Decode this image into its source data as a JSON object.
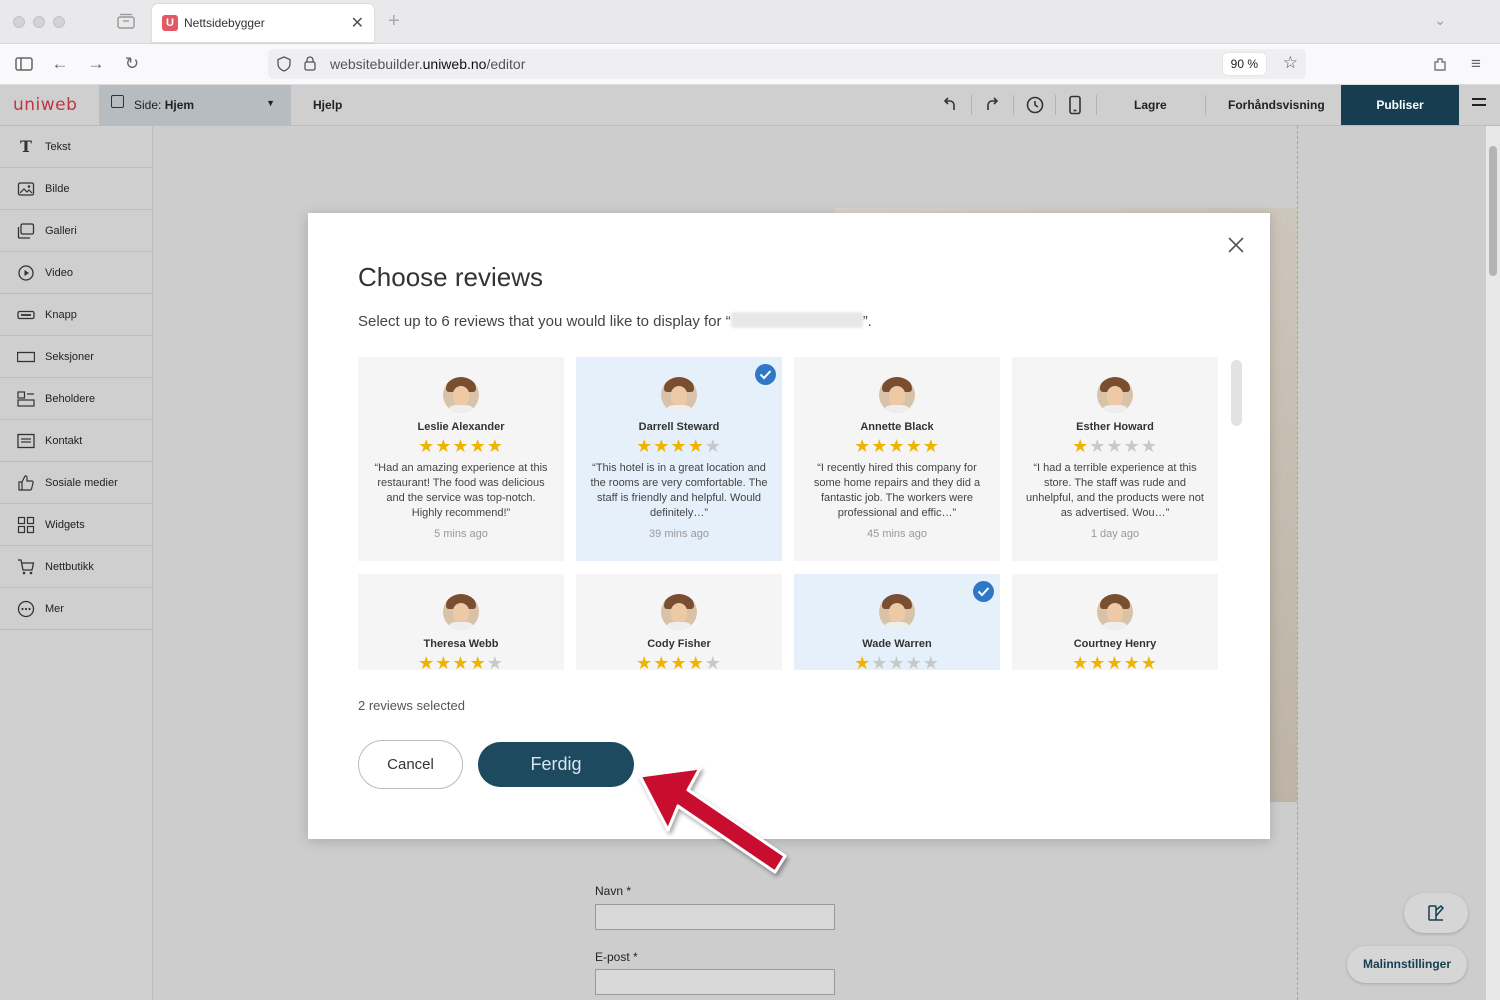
{
  "browser": {
    "tab_title": "Nettsidebygger",
    "tab_favicon": "U",
    "url_host": "websitebuilder.",
    "url_domain": "uniweb.no",
    "url_path": "/editor",
    "zoom": "90 %"
  },
  "editor": {
    "logo": "uniweb",
    "page_label": "Side:",
    "page_name": "Hjem",
    "help": "Hjelp",
    "save": "Lagre",
    "preview": "Forhåndsvisning",
    "publish": "Publiser"
  },
  "sidebar": {
    "items": [
      {
        "label": "Tekst",
        "icon": "text-icon"
      },
      {
        "label": "Bilde",
        "icon": "image-icon"
      },
      {
        "label": "Galleri",
        "icon": "gallery-icon"
      },
      {
        "label": "Video",
        "icon": "video-icon"
      },
      {
        "label": "Knapp",
        "icon": "button-icon"
      },
      {
        "label": "Seksjoner",
        "icon": "section-icon"
      },
      {
        "label": "Beholdere",
        "icon": "container-icon"
      },
      {
        "label": "Kontakt",
        "icon": "contact-icon"
      },
      {
        "label": "Sosiale medier",
        "icon": "thumbs-up-icon"
      },
      {
        "label": "Widgets",
        "icon": "widgets-icon"
      },
      {
        "label": "Nettbutikk",
        "icon": "cart-icon"
      },
      {
        "label": "Mer",
        "icon": "more-icon"
      }
    ]
  },
  "canvas": {
    "form_name_label": "Navn *",
    "form_email_label": "E-post *",
    "template_settings": "Malinnstillinger"
  },
  "modal": {
    "title": "Choose reviews",
    "subtitle_pre": "Select up to 6 reviews that you would like to display for “",
    "subtitle_post": "”.",
    "selected_count": "2 reviews selected",
    "cancel": "Cancel",
    "done": "Ferdig",
    "reviews": [
      {
        "name": "Leslie Alexander",
        "rating": 5,
        "quote": "“Had an amazing experience at this restaurant! The food was delicious and the service was top-notch. Highly recommend!”",
        "time": "5 mins ago",
        "selected": false
      },
      {
        "name": "Darrell Steward",
        "rating": 4,
        "quote": "“This hotel is in a great location and the rooms are very comfortable. The staff is friendly and helpful. Would definitely…”",
        "time": "39 mins ago",
        "selected": true
      },
      {
        "name": "Annette Black",
        "rating": 5,
        "quote": "“I recently hired this company for some home repairs and they did a fantastic job. The workers were professional and effic…”",
        "time": "45 mins ago",
        "selected": false
      },
      {
        "name": "Esther Howard",
        "rating": 1,
        "quote": "“I had a terrible experience at this store. The staff was rude and unhelpful, and the products were not as advertised. Wou…”",
        "time": "1 day ago",
        "selected": false
      },
      {
        "name": "Theresa Webb",
        "rating": 4,
        "quote": "",
        "time": "",
        "selected": false
      },
      {
        "name": "Cody Fisher",
        "rating": 4,
        "quote": "",
        "time": "",
        "selected": false
      },
      {
        "name": "Wade Warren",
        "rating": 1,
        "quote": "",
        "time": "",
        "selected": true
      },
      {
        "name": "Courtney Henry",
        "rating": 5,
        "quote": "",
        "time": "",
        "selected": false
      }
    ]
  },
  "colors": {
    "publish_bg": "#163e50",
    "done_bg": "#1d4a5f",
    "check_blue": "#2f78c8",
    "star_gold": "#f0b400",
    "selected_card": "#e6f0fa",
    "arrow_red": "#c8102e"
  }
}
